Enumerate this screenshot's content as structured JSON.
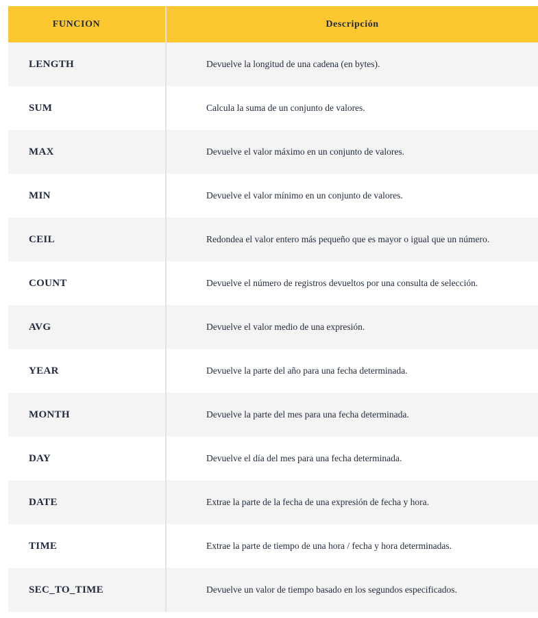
{
  "table": {
    "headers": [
      "FUNCION",
      "Descripción"
    ],
    "rows": [
      {
        "function": "LENGTH",
        "description": "Devuelve la longitud de una cadena (en bytes)."
      },
      {
        "function": "SUM",
        "description": "Calcula la suma de un conjunto de valores."
      },
      {
        "function": "MAX",
        "description": "Devuelve el valor máximo en un conjunto de valores."
      },
      {
        "function": "MIN",
        "description": "Devuelve el valor mínimo en un conjunto de valores."
      },
      {
        "function": "CEIL",
        "description": "Redondea el valor entero más pequeño que es mayor o igual que un número."
      },
      {
        "function": "COUNT",
        "description": "Devuelve el número de registros devueltos por una consulta de selección."
      },
      {
        "function": "AVG",
        "description": "Devuelve el valor medio de una expresión."
      },
      {
        "function": "YEAR",
        "description": "Devuelve la parte del año para una fecha determinada."
      },
      {
        "function": "MONTH",
        "description": "Devuelve la parte del mes para una fecha determinada."
      },
      {
        "function": "DAY",
        "description": "Devuelve el día del mes para una fecha determinada."
      },
      {
        "function": "DATE",
        "description": "Extrae la parte de la fecha de una expresión de fecha y hora."
      },
      {
        "function": "TIME",
        "description": "Extrae la parte de tiempo de una hora / fecha y hora determinadas."
      },
      {
        "function": "SEC_TO_TIME",
        "description": "Devuelve un valor de tiempo basado en los segundos especificados."
      }
    ]
  },
  "colors": {
    "header_bg": "#fdc82f",
    "stripe_bg": "#f4f4f4",
    "text": "#1f2a3d"
  }
}
